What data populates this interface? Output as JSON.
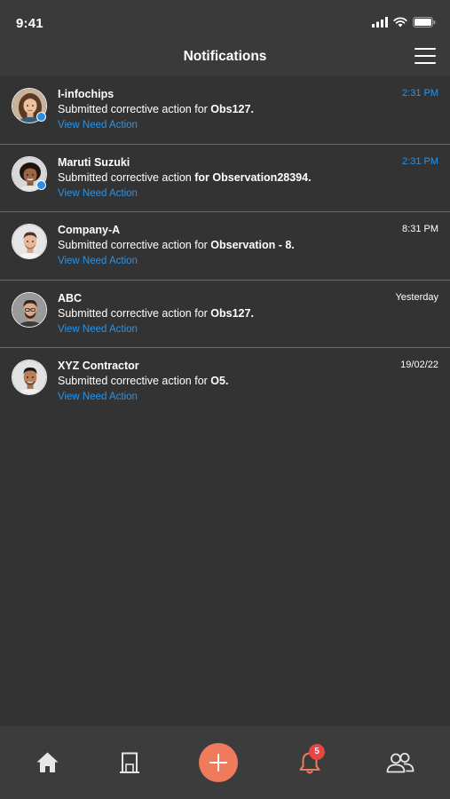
{
  "status_bar": {
    "time": "9:41"
  },
  "header": {
    "title": "Notifications"
  },
  "notifications": [
    {
      "name": "I-infochips",
      "message_prefix": "Submitted corrective action for ",
      "message_bold": "Obs127.",
      "link": "View Need Action",
      "time": "2:31 PM",
      "unread": true
    },
    {
      "name": "Maruti Suzuki",
      "message_prefix": "Submitted corrective action ",
      "message_bold": "for Observation28394.",
      "link": "View Need Action",
      "time": "2:31 PM",
      "unread": true
    },
    {
      "name": "Company-A",
      "message_prefix": "Submitted corrective action for ",
      "message_bold": "Observation - 8.",
      "link": "View Need Action",
      "time": "8:31 PM",
      "unread": false
    },
    {
      "name": "ABC",
      "message_prefix": "Submitted corrective action for ",
      "message_bold": "Obs127.",
      "link": "View Need Action",
      "time": "Yesterday",
      "unread": false
    },
    {
      "name": "XYZ Contractor",
      "message_prefix": "Submitted corrective action for ",
      "message_bold": "O5.",
      "link": "View Need Action",
      "time": "19/02/22",
      "unread": false
    }
  ],
  "tab_bar": {
    "items": [
      "home-icon",
      "building-icon",
      "add-icon",
      "bell-icon",
      "users-icon"
    ],
    "notification_count": "5"
  },
  "colors": {
    "accent": "#2196f3",
    "fab": "#ef7a5c",
    "badge": "#e84545",
    "background": "#333333"
  }
}
